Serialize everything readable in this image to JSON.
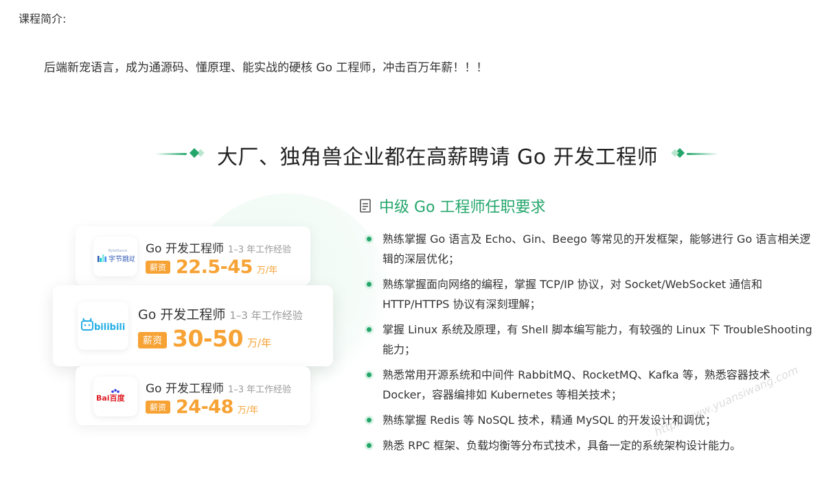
{
  "intro": {
    "label": "课程简介:",
    "text": "后端新宠语言，成为通源码、懂原理、能实战的硬核 Go 工程师，冲击百万年薪！！！"
  },
  "section": {
    "title": "大厂、独角兽企业都在高薪聘请 Go 开发工程师"
  },
  "jobs": [
    {
      "company_logo_text": "字节跳动",
      "company_logo_sub": "ByteDance",
      "title": "Go 开发工程师",
      "experience": "1–3 年工作经验",
      "salary_tag": "薪资",
      "salary": "22.5-45",
      "unit": "万/年"
    },
    {
      "company_logo_text": "bilibili",
      "title": "Go 开发工程师",
      "experience": "1–3 年工作经验",
      "salary_tag": "薪资",
      "salary": "30-50",
      "unit": "万/年"
    },
    {
      "company_logo_text": "Bai百度",
      "title": "Go 开发工程师",
      "experience": "1–3 年工作经验",
      "salary_tag": "薪资",
      "salary": "24-48",
      "unit": "万/年"
    }
  ],
  "requirements": {
    "icon": "document-icon",
    "title": "中级 Go 工程师任职要求",
    "items": [
      "熟练掌握 Go 语言及 Echo、Gin、Beego 等常见的开发框架，能够进行 Go 语言相关逻辑的深层优化；",
      "熟练掌握面向网络的编程，掌握 TCP/IP 协议，对 Socket/WebSocket 通信和 HTTP/HTTPS 协议有深刻理解；",
      "掌握 Linux 系统及原理，有 Shell 脚本编写能力，有较强的 Linux 下 TroubleShooting 能力；",
      "熟悉常用开源系统和中间件 RabbitMQ、RocketMQ、Kafka 等，熟悉容器技术 Docker，容器编排如 Kubernetes 等相关技术；",
      "熟练掌握 Redis 等 NoSQL 技术，精通 MySQL 的开发设计和调优；",
      "熟悉 RPC 框架、负载均衡等分布式技术，具备一定的系统架构设计能力。"
    ]
  },
  "watermark": "http://www.yuansiwang.com",
  "colors": {
    "accent_green": "#24a66b",
    "salary_orange": "#f7a234",
    "bilibili_blue": "#23ade5",
    "baidu_red": "#de1f26",
    "baidu_blue": "#2932e1"
  }
}
